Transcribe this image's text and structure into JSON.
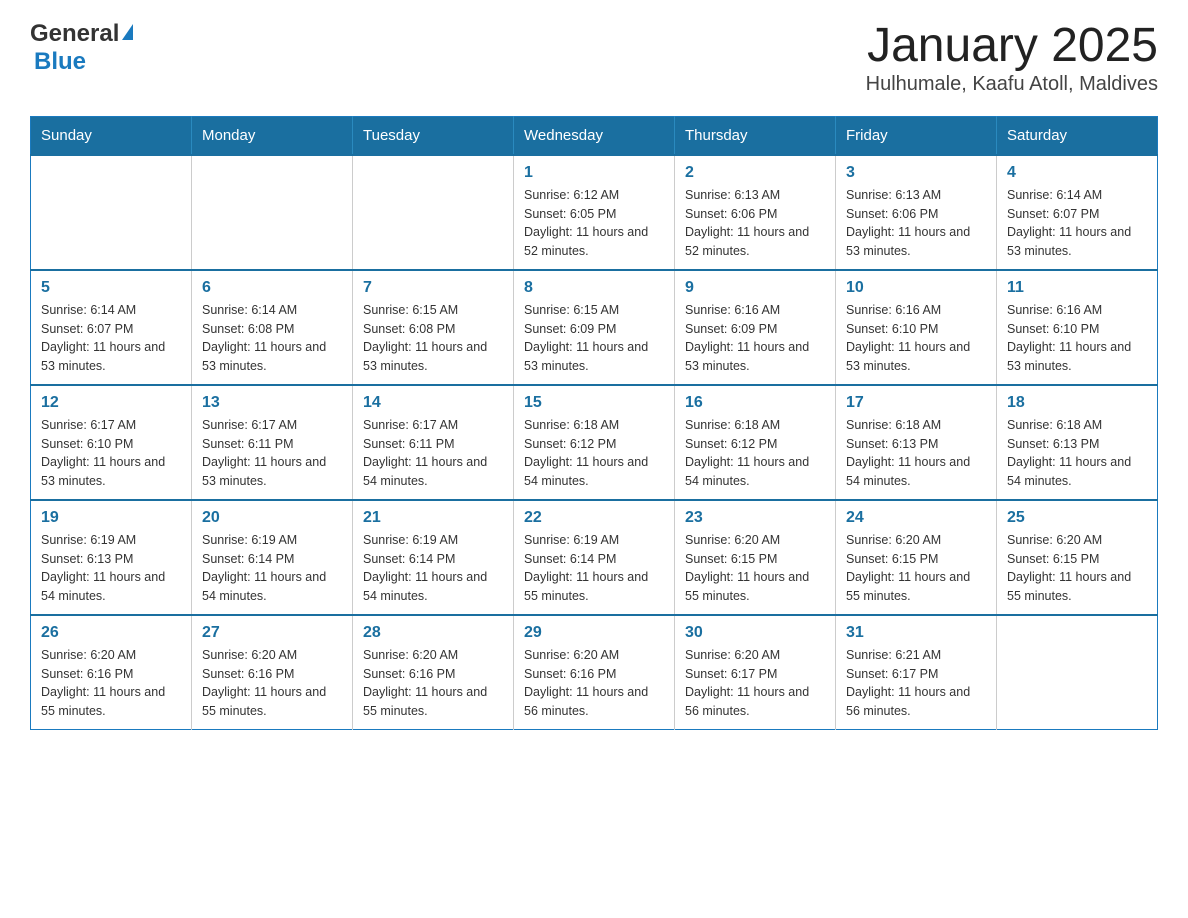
{
  "logo": {
    "general": "General",
    "blue": "Blue"
  },
  "title": "January 2025",
  "subtitle": "Hulhumale, Kaafu Atoll, Maldives",
  "weekdays": [
    "Sunday",
    "Monday",
    "Tuesday",
    "Wednesday",
    "Thursday",
    "Friday",
    "Saturday"
  ],
  "weeks": [
    [
      {
        "day": "",
        "info": ""
      },
      {
        "day": "",
        "info": ""
      },
      {
        "day": "",
        "info": ""
      },
      {
        "day": "1",
        "info": "Sunrise: 6:12 AM\nSunset: 6:05 PM\nDaylight: 11 hours and 52 minutes."
      },
      {
        "day": "2",
        "info": "Sunrise: 6:13 AM\nSunset: 6:06 PM\nDaylight: 11 hours and 52 minutes."
      },
      {
        "day": "3",
        "info": "Sunrise: 6:13 AM\nSunset: 6:06 PM\nDaylight: 11 hours and 53 minutes."
      },
      {
        "day": "4",
        "info": "Sunrise: 6:14 AM\nSunset: 6:07 PM\nDaylight: 11 hours and 53 minutes."
      }
    ],
    [
      {
        "day": "5",
        "info": "Sunrise: 6:14 AM\nSunset: 6:07 PM\nDaylight: 11 hours and 53 minutes."
      },
      {
        "day": "6",
        "info": "Sunrise: 6:14 AM\nSunset: 6:08 PM\nDaylight: 11 hours and 53 minutes."
      },
      {
        "day": "7",
        "info": "Sunrise: 6:15 AM\nSunset: 6:08 PM\nDaylight: 11 hours and 53 minutes."
      },
      {
        "day": "8",
        "info": "Sunrise: 6:15 AM\nSunset: 6:09 PM\nDaylight: 11 hours and 53 minutes."
      },
      {
        "day": "9",
        "info": "Sunrise: 6:16 AM\nSunset: 6:09 PM\nDaylight: 11 hours and 53 minutes."
      },
      {
        "day": "10",
        "info": "Sunrise: 6:16 AM\nSunset: 6:10 PM\nDaylight: 11 hours and 53 minutes."
      },
      {
        "day": "11",
        "info": "Sunrise: 6:16 AM\nSunset: 6:10 PM\nDaylight: 11 hours and 53 minutes."
      }
    ],
    [
      {
        "day": "12",
        "info": "Sunrise: 6:17 AM\nSunset: 6:10 PM\nDaylight: 11 hours and 53 minutes."
      },
      {
        "day": "13",
        "info": "Sunrise: 6:17 AM\nSunset: 6:11 PM\nDaylight: 11 hours and 53 minutes."
      },
      {
        "day": "14",
        "info": "Sunrise: 6:17 AM\nSunset: 6:11 PM\nDaylight: 11 hours and 54 minutes."
      },
      {
        "day": "15",
        "info": "Sunrise: 6:18 AM\nSunset: 6:12 PM\nDaylight: 11 hours and 54 minutes."
      },
      {
        "day": "16",
        "info": "Sunrise: 6:18 AM\nSunset: 6:12 PM\nDaylight: 11 hours and 54 minutes."
      },
      {
        "day": "17",
        "info": "Sunrise: 6:18 AM\nSunset: 6:13 PM\nDaylight: 11 hours and 54 minutes."
      },
      {
        "day": "18",
        "info": "Sunrise: 6:18 AM\nSunset: 6:13 PM\nDaylight: 11 hours and 54 minutes."
      }
    ],
    [
      {
        "day": "19",
        "info": "Sunrise: 6:19 AM\nSunset: 6:13 PM\nDaylight: 11 hours and 54 minutes."
      },
      {
        "day": "20",
        "info": "Sunrise: 6:19 AM\nSunset: 6:14 PM\nDaylight: 11 hours and 54 minutes."
      },
      {
        "day": "21",
        "info": "Sunrise: 6:19 AM\nSunset: 6:14 PM\nDaylight: 11 hours and 54 minutes."
      },
      {
        "day": "22",
        "info": "Sunrise: 6:19 AM\nSunset: 6:14 PM\nDaylight: 11 hours and 55 minutes."
      },
      {
        "day": "23",
        "info": "Sunrise: 6:20 AM\nSunset: 6:15 PM\nDaylight: 11 hours and 55 minutes."
      },
      {
        "day": "24",
        "info": "Sunrise: 6:20 AM\nSunset: 6:15 PM\nDaylight: 11 hours and 55 minutes."
      },
      {
        "day": "25",
        "info": "Sunrise: 6:20 AM\nSunset: 6:15 PM\nDaylight: 11 hours and 55 minutes."
      }
    ],
    [
      {
        "day": "26",
        "info": "Sunrise: 6:20 AM\nSunset: 6:16 PM\nDaylight: 11 hours and 55 minutes."
      },
      {
        "day": "27",
        "info": "Sunrise: 6:20 AM\nSunset: 6:16 PM\nDaylight: 11 hours and 55 minutes."
      },
      {
        "day": "28",
        "info": "Sunrise: 6:20 AM\nSunset: 6:16 PM\nDaylight: 11 hours and 55 minutes."
      },
      {
        "day": "29",
        "info": "Sunrise: 6:20 AM\nSunset: 6:16 PM\nDaylight: 11 hours and 56 minutes."
      },
      {
        "day": "30",
        "info": "Sunrise: 6:20 AM\nSunset: 6:17 PM\nDaylight: 11 hours and 56 minutes."
      },
      {
        "day": "31",
        "info": "Sunrise: 6:21 AM\nSunset: 6:17 PM\nDaylight: 11 hours and 56 minutes."
      },
      {
        "day": "",
        "info": ""
      }
    ]
  ]
}
